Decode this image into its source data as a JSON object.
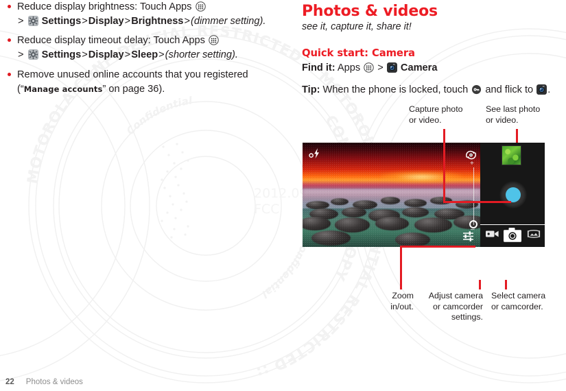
{
  "watermark": {
    "date_line": "2012.09.2",
    "agency_line": "FCC",
    "ring_text": "MOTOROLA CONFIDENTIAL RESTRICTED :: MOTOROLA CONFIDENTIAL RESTRICTED ::",
    "copy_text": "CONTROLLED COPY",
    "inner_text": "Confidential"
  },
  "left_column": {
    "bullets": [
      {
        "id": "reduce-brightness",
        "parts": [
          {
            "t": "Reduce display brightness: Touch Apps ",
            "style": "normal"
          },
          {
            "t": "apps-icon",
            "style": "icon"
          },
          {
            "t": " > ",
            "style": "normal"
          },
          {
            "t": "settings-icon",
            "style": "icon"
          },
          {
            "t": " Settings",
            "style": "bold"
          },
          {
            "t": " > ",
            "style": "normal"
          },
          {
            "t": "Display",
            "style": "bold"
          },
          {
            "t": " > ",
            "style": "normal"
          },
          {
            "t": "Brightness",
            "style": "bold"
          },
          {
            "t": " > ",
            "style": "normal"
          },
          {
            "t": "(dimmer setting).",
            "style": "italic"
          }
        ]
      },
      {
        "id": "reduce-timeout",
        "parts": [
          {
            "t": "Reduce display timeout delay: Touch Apps ",
            "style": "normal"
          },
          {
            "t": "apps-icon",
            "style": "icon"
          },
          {
            "t": " > ",
            "style": "normal"
          },
          {
            "t": "settings-icon",
            "style": "icon"
          },
          {
            "t": " Settings",
            "style": "bold"
          },
          {
            "t": " > ",
            "style": "normal"
          },
          {
            "t": "Display",
            "style": "bold"
          },
          {
            "t": " > ",
            "style": "normal"
          },
          {
            "t": "Sleep",
            "style": "bold"
          },
          {
            "t": " > ",
            "style": "normal"
          },
          {
            "t": "(shorter setting).",
            "style": "italic"
          }
        ]
      },
      {
        "id": "remove-accounts",
        "parts": [
          {
            "t": "Remove unused online accounts that you registered (“",
            "style": "normal"
          },
          {
            "t": "Manage accounts",
            "style": "smallcaps"
          },
          {
            "t": "” on page 36).",
            "style": "normal"
          }
        ]
      }
    ]
  },
  "right_column": {
    "heading": "Photos & videos",
    "subheading": "see it, capture it, share it!",
    "section_heading": "Quick start: Camera",
    "find_it_label": "Find it:",
    "find_it_pre": " Apps ",
    "find_it_sep": " > ",
    "find_it_app": "Camera",
    "tip_label": "Tip:",
    "tip_pre": " When the phone is locked, touch ",
    "tip_mid": " and flick to ",
    "tip_post": "."
  },
  "figure": {
    "callouts": [
      {
        "id": "capture-photo",
        "text": "Capture photo\nor video."
      },
      {
        "id": "see-last-photo",
        "text": "See last photo\nor video."
      },
      {
        "id": "zoom-in-out",
        "text": "Zoom\nin/out."
      },
      {
        "id": "adjust-settings",
        "text": "Adjust camera\nor camcorder\nsettings."
      },
      {
        "id": "select-camera",
        "text": "Select camera\nor camcorder."
      }
    ],
    "callout_capture_l1": "Capture photo",
    "callout_capture_l2": "or video.",
    "callout_lastphoto_l1": "See last photo",
    "callout_lastphoto_l2": "or video.",
    "callout_zoom_l1": "Zoom",
    "callout_zoom_l2": "in/out.",
    "callout_adjust_l1": "Adjust camera",
    "callout_adjust_l2": "or camcorder",
    "callout_adjust_l3": "settings.",
    "callout_select_l1": "Select camera",
    "callout_select_l2": "or camcorder.",
    "zoom_plus": "+",
    "zoom_minus": "–",
    "accent_color": "#e31b23",
    "shutter_color": "#4fc3e8"
  },
  "footer": {
    "page_number": "22",
    "section_label": "Photos & videos"
  }
}
